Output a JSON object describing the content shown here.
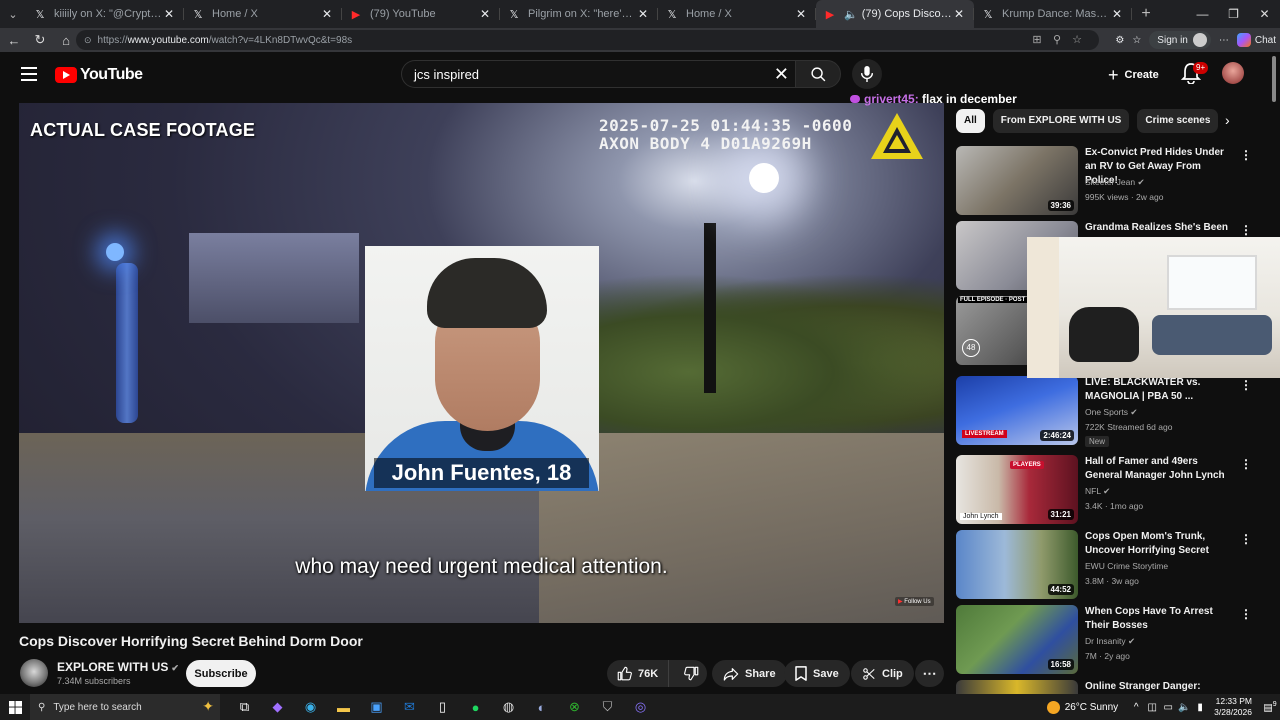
{
  "browser": {
    "tabs": [
      {
        "title": "kiiiily on X: \"@CryptoFooo @Fea",
        "icon": "x-icon"
      },
      {
        "title": "Home / X",
        "icon": "x-icon"
      },
      {
        "title": "(79) YouTube",
        "icon": "youtube-icon"
      },
      {
        "title": "Pilgrim on X: \"here's what claviculi",
        "icon": "x-icon"
      },
      {
        "title": "Home / X",
        "icon": "x-icon"
      },
      {
        "title": "(79) Cops Discover Horrifying",
        "icon": "youtube-icon",
        "active": true,
        "audio": true
      },
      {
        "title": "Krump Dance: Mastering the Esse",
        "icon": "krump-icon"
      }
    ],
    "url_prefix": "https://",
    "url_host": "www.youtube.com",
    "url_path": "/watch?v=4LKn8DTwvQc&t=98s",
    "signin_label": "Sign in",
    "copilot_label": "Chat"
  },
  "youtube": {
    "logo_text": "YouTube",
    "search_value": "jcs inspired",
    "create_label": "Create",
    "notif_count": "9+"
  },
  "player": {
    "overlay_left": "ACTUAL CASE FOOTAGE",
    "timestamp_line1": "2025-07-25 01:44:35 -0600",
    "timestamp_line2": "AXON BODY 4 D01A9269H",
    "chat_user": "grivert45:",
    "chat_message": "flax in december",
    "name_caption": "John Fuentes, 18",
    "subtitle": "who may need urgent medical attention.",
    "follow_label": "Follow Us"
  },
  "video": {
    "title": "Cops Discover Horrifying Secret Behind Dorm Door",
    "channel": "EXPLORE WITH US",
    "subscribers": "7.34M subscribers",
    "subscribe_label": "Subscribe",
    "likes": "76K",
    "share_label": "Share",
    "save_label": "Save",
    "clip_label": "Clip"
  },
  "sidebar": {
    "chips": [
      "All",
      "From EXPLORE WITH US",
      "Crime scenes"
    ],
    "recommendations": [
      {
        "title": "Ex-Convict Pred Hides Under an RV to Get Away From Police!",
        "channel": "Skeeter Jean",
        "verified": true,
        "meta": "995K views · 2w ago",
        "duration": "39:36"
      },
      {
        "title": "Grandma Realizes She's Been",
        "channel": "",
        "verified": false,
        "meta": "",
        "duration": ""
      },
      {
        "title": "",
        "channel": "",
        "verified": false,
        "meta": "",
        "duration": "48",
        "badge": "FULL EPISODE · POST"
      },
      {
        "title": "LIVE: BLACKWATER vs. MAGNOLIA | PBA 50 ...",
        "channel": "One Sports",
        "verified": true,
        "meta": "722K  Streamed 6d ago",
        "duration": "2:46:24",
        "new": "New",
        "banner": "LIVESTREAM"
      },
      {
        "title": "Hall of Famer and 49ers General Manager John Lynch",
        "channel": "NFL",
        "verified": true,
        "meta": "3.4K · 1mo ago",
        "duration": "31:21",
        "caption": "John Lynch",
        "banner": "PLAYERS"
      },
      {
        "title": "Cops Open Mom's Trunk, Uncover Horrifying Secret",
        "channel": "EWU Crime Storytime",
        "verified": false,
        "meta": "3.8M · 3w ago",
        "duration": "44:52"
      },
      {
        "title": "When Cops Have To Arrest Their Bosses",
        "channel": "Dr Insanity",
        "verified": true,
        "meta": "7M · 2y ago",
        "duration": "16:58"
      },
      {
        "title": "Online Stranger Danger: Breck's",
        "channel": "",
        "verified": false,
        "meta": "",
        "duration": ""
      }
    ]
  },
  "taskbar": {
    "search_placeholder": "Type here to search",
    "weather": "26°C  Sunny",
    "time": "12:33 PM",
    "date": "3/28/2026",
    "notif_count": "9"
  }
}
